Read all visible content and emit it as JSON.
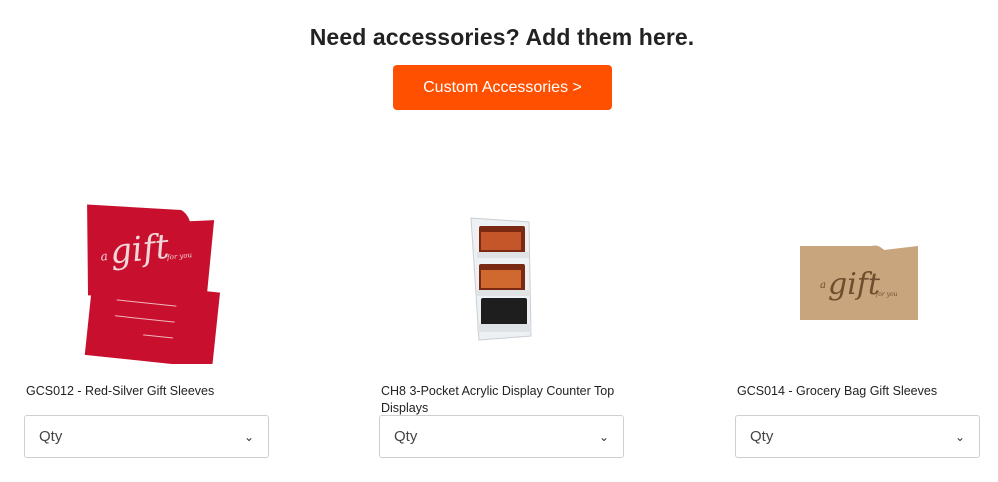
{
  "section": {
    "heading": "Need accessories? Add them here.",
    "cta_label": "Custom Accessories >"
  },
  "products": [
    {
      "name": "GCS012 - Red-Silver Gift Sleeves",
      "qty_placeholder": "Qty",
      "image_icon": "red-gift-sleeve-image"
    },
    {
      "name": "CH8 3-Pocket Acrylic Display Counter Top Displays",
      "qty_placeholder": "Qty",
      "image_icon": "acrylic-display-image"
    },
    {
      "name": "GCS014 - Grocery Bag Gift Sleeves",
      "qty_placeholder": "Qty",
      "image_icon": "kraft-gift-sleeve-image"
    }
  ],
  "sleeve_script": {
    "a": "a",
    "gift": "gift",
    "for_you": "for you"
  },
  "colors": {
    "accent": "#ff5000",
    "red_sleeve": "#c8102e",
    "kraft": "#c9a57d"
  }
}
